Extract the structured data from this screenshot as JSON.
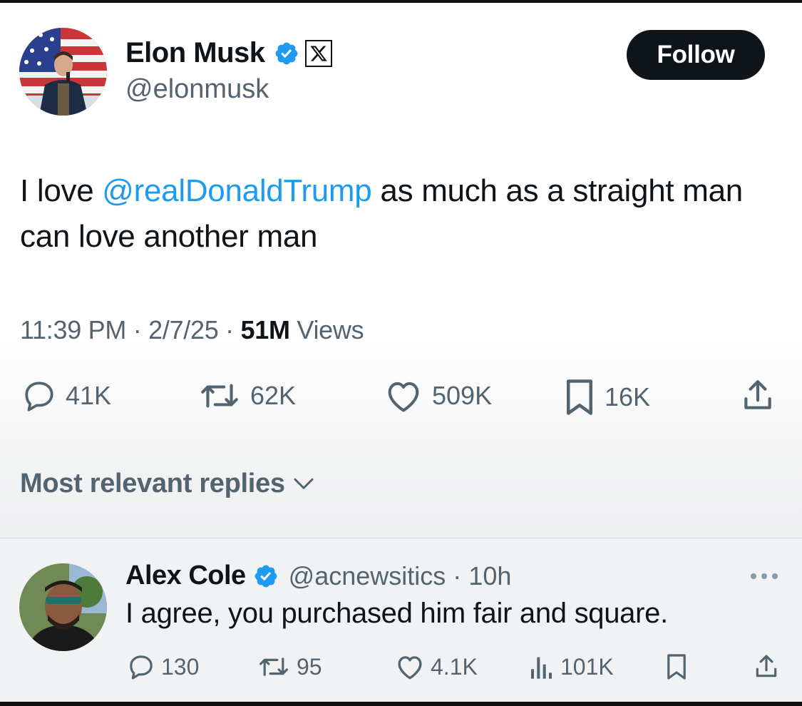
{
  "tweet": {
    "author_name": "Elon Musk",
    "author_handle": "@elonmusk",
    "follow_label": "Follow",
    "text_before": "I love ",
    "mention": "@realDonaldTrump",
    "text_after": " as much as a straight man can love another man",
    "time": "11:39 PM",
    "date": "2/7/25",
    "views_count": "51M",
    "views_label": "Views",
    "separator": "·"
  },
  "actions": {
    "replies": "41K",
    "reposts": "62K",
    "likes": "509K",
    "bookmarks": "16K"
  },
  "replies_filter": {
    "label": "Most relevant replies"
  },
  "reply": {
    "name": "Alex Cole",
    "handle": "@acnewsitics",
    "time": "10h",
    "text": "I agree, you purchased him fair and square.",
    "replies": "130",
    "reposts": "95",
    "likes": "4.1K",
    "views": "101K"
  },
  "icons": {
    "verified": "verified-badge-icon",
    "affiliate": "x-logo-icon",
    "reply": "reply-icon",
    "repost": "repost-icon",
    "like": "heart-icon",
    "bookmark": "bookmark-icon",
    "share": "share-icon",
    "views": "views-icon",
    "more": "more-dots-icon",
    "chevron": "chevron-down-icon"
  },
  "colors": {
    "accent": "#1d9bf0",
    "text": "#0f1419",
    "muted": "#536471",
    "button": "#0f1419"
  }
}
